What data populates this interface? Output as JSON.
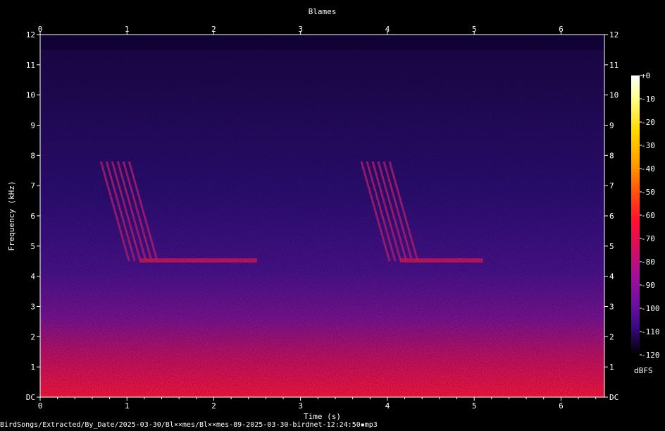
{
  "chart_data": {
    "type": "heatmap",
    "title": "Blames",
    "xlabel": "Time (s)",
    "ylabel": "Frequency (kHz)",
    "xlim": [
      0,
      6.5
    ],
    "ylim": [
      0,
      12
    ],
    "x_ticks": [
      "0",
      "1",
      "2",
      "3",
      "4",
      "5",
      "6"
    ],
    "y_ticks": [
      "DC",
      "1",
      "2",
      "3",
      "4",
      "5",
      "6",
      "7",
      "8",
      "9",
      "10",
      "11",
      "12"
    ],
    "colorbar": {
      "label": "dBFS",
      "range": [
        -120,
        0
      ],
      "ticks": [
        "+0",
        "-10",
        "-20",
        "-30",
        "-40",
        "-50",
        "-60",
        "-70",
        "-80",
        "-90",
        "-100",
        "-110",
        "-120"
      ],
      "colormap": [
        "#000000",
        "#1a0040",
        "#3a0a80",
        "#6a10a0",
        "#a0109a",
        "#d01060",
        "#ff1030",
        "#ff5010",
        "#ff9a00",
        "#ffd800",
        "#ffffa0",
        "#ffffff"
      ]
    },
    "annotations": [
      {
        "name": "call-1",
        "t_start": 0.7,
        "t_end": 2.5,
        "f_low_khz": 4.5,
        "f_high_khz": 7.8
      },
      {
        "name": "call-2",
        "t_start": 3.7,
        "t_end": 5.1,
        "f_low_khz": 4.5,
        "f_high_khz": 7.8
      }
    ],
    "grid": true
  },
  "footer": {
    "file_path": "BirdSongs/Extracted/By_Date/2025-03-30/Bl××mes/Bl××mes-89-2025-03-30-birdnet-12:24:50▪mp3"
  }
}
